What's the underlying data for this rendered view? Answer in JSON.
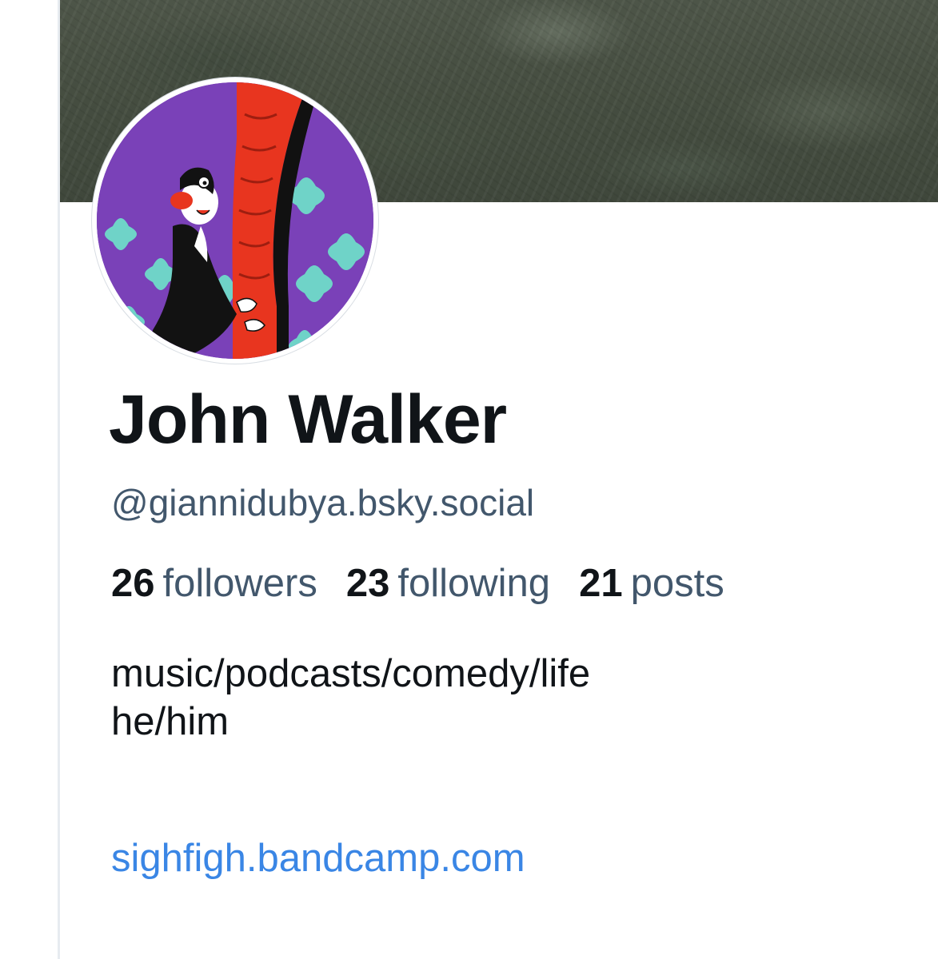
{
  "profile": {
    "display_name": "John Walker",
    "handle": "@giannidubya.bsky.social",
    "stats": {
      "followers_count": "26",
      "followers_label": "followers",
      "following_count": "23",
      "following_label": "following",
      "posts_count": "21",
      "posts_label": "posts"
    },
    "bio_lines": [
      "music/podcasts/comedy/life",
      "he/him"
    ],
    "link": "sighfigh.bandcamp.com"
  },
  "colors": {
    "text_primary": "#101418",
    "text_secondary": "#42576c",
    "link": "#3a86e5",
    "avatar_background": "#7a41b8",
    "banner": "#4a5245"
  },
  "icons": {
    "avatar": "cartoon-cat-avatar"
  }
}
